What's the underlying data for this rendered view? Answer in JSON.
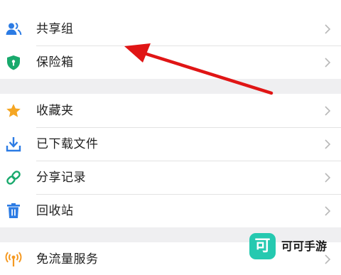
{
  "menu": {
    "group1": [
      {
        "label": "共享组",
        "icon": "people-icon"
      },
      {
        "label": "保险箱",
        "icon": "shield-icon"
      }
    ],
    "group2": [
      {
        "label": "收藏夹",
        "icon": "star-icon"
      },
      {
        "label": "已下载文件",
        "icon": "download-icon"
      },
      {
        "label": "分享记录",
        "icon": "link-icon"
      },
      {
        "label": "回收站",
        "icon": "trash-icon"
      }
    ],
    "group3": [
      {
        "label": "免流量服务",
        "icon": "signal-icon"
      }
    ]
  },
  "watermark": {
    "logo_char": "可",
    "text": "可可手游"
  },
  "colors": {
    "icon_blue": "#2b7be4",
    "icon_green": "#18a96c",
    "icon_star": "#f5a623",
    "icon_orange": "#f59a23",
    "arrow_red": "#e01515",
    "watermark_teal": "#25c9b0",
    "section_gap": "#efeff1"
  }
}
